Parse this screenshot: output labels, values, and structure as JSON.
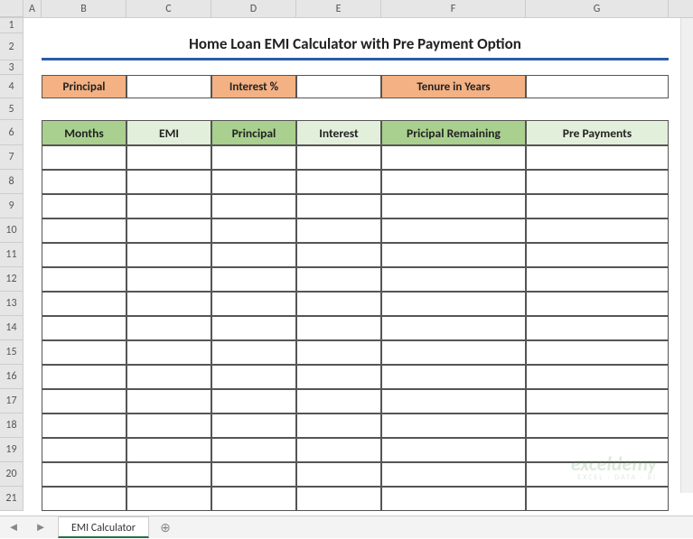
{
  "columns": [
    "A",
    "B",
    "C",
    "D",
    "E",
    "F",
    "G"
  ],
  "row_numbers": [
    1,
    2,
    3,
    4,
    5,
    6,
    7,
    8,
    9,
    10,
    11,
    12,
    13,
    14,
    15,
    16,
    17,
    18,
    19,
    20,
    21
  ],
  "title": "Home Loan EMI Calculator with Pre Payment Option",
  "inputs": {
    "principal_label": "Principal",
    "principal_value": "",
    "interest_label": "Interest %",
    "interest_value": "",
    "tenure_label": "Tenure in Years",
    "tenure_value": ""
  },
  "table_headers": {
    "months": "Months",
    "emi": "EMI",
    "principal": "Principal",
    "interest": "Interest",
    "remaining": "Pricipal Remaining",
    "prepay": "Pre Payments"
  },
  "empty_rows": 15,
  "sheet_tab": "EMI Calculator",
  "watermark": {
    "main": "exceldemy",
    "sub": "EXCEL · DATA · BI"
  }
}
